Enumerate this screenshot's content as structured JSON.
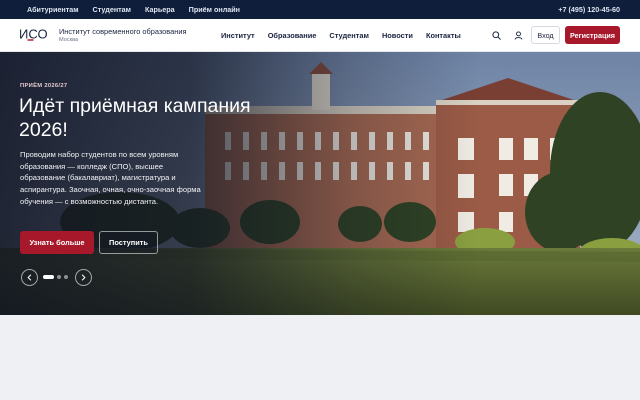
{
  "topbar": {
    "links": [
      "Абитуриентам",
      "Студентам",
      "Карьера",
      "Приём онлайн"
    ],
    "phone": "+7 (495) 120-45-60"
  },
  "header": {
    "logo_mark": "ИСО",
    "org_name": "Институт современного образования",
    "city": "Москва",
    "nav": [
      "Институт",
      "Образование",
      "Студентам",
      "Новости",
      "Контакты"
    ],
    "login_label": "Вход",
    "register_label": "Регистрация",
    "icons": [
      "search-icon",
      "user-icon"
    ]
  },
  "hero": {
    "eyebrow": "ПРИЁМ 2026/27",
    "title": "Идёт приёмная кампания 2026!",
    "description": "Проводим набор студентов по всем уровням образования — колледж (СПО), высшее образование (бакалавриат), магистратура и аспирантура. Заочная, очная, очно-заочная форма обучения — с возможностью дистанта.",
    "primary_cta": "Узнать больше",
    "secondary_cta": "Поступить",
    "slides_total": 3,
    "active_slide": 1
  },
  "colors": {
    "topbar_bg": "#0f1e3a",
    "accent": "#a8182b",
    "page_bg": "#eef0f4"
  }
}
